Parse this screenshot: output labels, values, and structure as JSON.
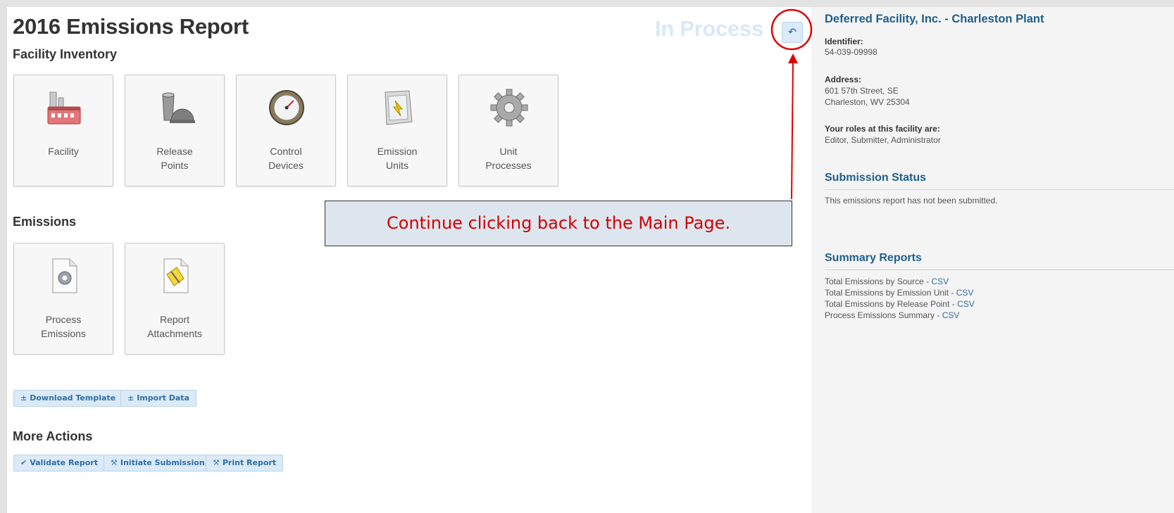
{
  "report": {
    "title": "2016 Emissions Report",
    "status": "In Process",
    "back_icon": "reply-icon"
  },
  "facility_inventory": {
    "heading": "Facility Inventory",
    "tiles": [
      {
        "line1": "Facility",
        "line2": "",
        "icon": "factory-icon"
      },
      {
        "line1": "Release",
        "line2": "Points",
        "icon": "stack-icon"
      },
      {
        "line1": "Control",
        "line2": "Devices",
        "icon": "gauge-icon"
      },
      {
        "line1": "Emission",
        "line2": "Units",
        "icon": "cabinet-icon"
      },
      {
        "line1": "Unit",
        "line2": "Processes",
        "icon": "gear-icon"
      }
    ]
  },
  "emissions": {
    "heading": "Emissions",
    "tiles": [
      {
        "line1": "Process",
        "line2": "Emissions",
        "icon": "document-gear-icon"
      },
      {
        "line1": "Report",
        "line2": "Attachments",
        "icon": "document-attachment-icon"
      }
    ]
  },
  "data_actions": {
    "download_template": "Download Template",
    "import_data": "Import Data"
  },
  "more_actions": {
    "heading": "More Actions",
    "validate": "Validate Report",
    "initiate": "Initiate Submission",
    "print": "Print Report"
  },
  "callout": {
    "text": "Continue clicking back to the Main Page.",
    "color": "#d40000"
  },
  "sidebar": {
    "facility_name": "Deferred Facility, Inc. - Charleston Plant",
    "identifier_label": "Identifier:",
    "identifier": "54-039-09998",
    "address_label": "Address:",
    "address_line1": "601 57th Street, SE",
    "address_line2": "Charleston, WV 25304",
    "roles_label": "Your roles at this facility are:",
    "roles": "Editor, Submitter, Administrator",
    "submission_heading": "Submission Status",
    "submission_text": "This emissions report has not been submitted.",
    "summary_heading": "Summary Reports",
    "summary": [
      {
        "label": "Total Emissions by Source",
        "link": "CSV"
      },
      {
        "label": "Total Emissions by Emission Unit",
        "link": "CSV"
      },
      {
        "label": "Total Emissions by Release Point",
        "link": "CSV"
      },
      {
        "label": "Process Emissions Summary",
        "link": "CSV"
      }
    ],
    "separator": " - "
  },
  "colors": {
    "accent": "#2f6ea8",
    "heading_blue": "#1e5f8c",
    "status_faded": "#d8e9f6",
    "button_bg": "#dbeaf6"
  }
}
